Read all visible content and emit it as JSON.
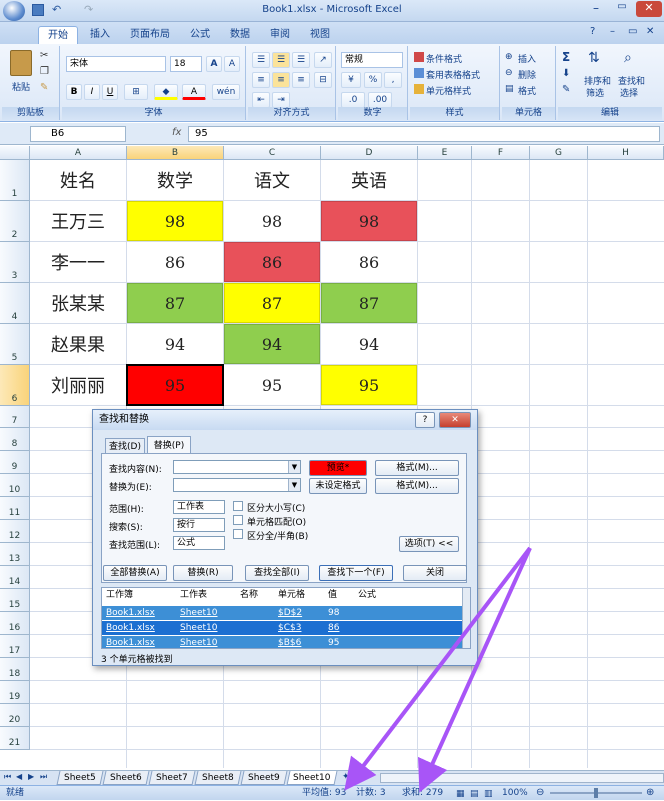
{
  "window": {
    "title": "Book1.xlsx - Microsoft Excel"
  },
  "ribbon_tabs": [
    "开始",
    "插入",
    "页面布局",
    "公式",
    "数据",
    "审阅",
    "视图"
  ],
  "ribbon": {
    "clipboard": {
      "label": "剪贴板",
      "paste": "粘贴"
    },
    "font": {
      "label": "字体",
      "name": "宋体",
      "size": "18",
      "bold": "B",
      "italic": "I",
      "underline": "U",
      "grow": "A",
      "shrink": "A",
      "phonetic": "wén"
    },
    "alignment": {
      "label": "对齐方式"
    },
    "number": {
      "label": "数字",
      "format": "常规",
      "percent": "%",
      "comma": ","
    },
    "styles": {
      "label": "样式",
      "conditional": "条件格式",
      "table": "套用表格格式",
      "cell": "单元格样式"
    },
    "cells": {
      "label": "单元格",
      "insert": "插入",
      "delete": "删除",
      "format": "格式"
    },
    "editing": {
      "label": "编辑",
      "sum": "Σ",
      "sort": "排序和",
      "sort2": "筛选",
      "find": "查找和",
      "find2": "选择"
    }
  },
  "formula_bar": {
    "name_box": "B6",
    "fx": "fx",
    "value": "95"
  },
  "columns": [
    "A",
    "B",
    "C",
    "D",
    "E",
    "F",
    "G",
    "H"
  ],
  "rows": [
    "1",
    "2",
    "3",
    "4",
    "5",
    "6",
    "7",
    "8",
    "9",
    "10",
    "11",
    "12",
    "13",
    "14",
    "15",
    "16",
    "17",
    "18",
    "19",
    "20",
    "21"
  ],
  "table": {
    "headers": [
      "姓名",
      "数学",
      "语文",
      "英语"
    ],
    "rows": [
      {
        "name": "王万三",
        "scores": [
          "98",
          "98",
          "98"
        ],
        "colors": [
          "#ffff00",
          "#ffffff",
          "#e8515a"
        ]
      },
      {
        "name": "李一一",
        "scores": [
          "86",
          "86",
          "86"
        ],
        "colors": [
          "#ffffff",
          "#e8515a",
          "#ffffff"
        ]
      },
      {
        "name": "张某某",
        "scores": [
          "87",
          "87",
          "87"
        ],
        "colors": [
          "#8fce4e",
          "#ffff00",
          "#8fce4e"
        ]
      },
      {
        "name": "赵果果",
        "scores": [
          "94",
          "94",
          "94"
        ],
        "colors": [
          "#ffffff",
          "#8fce4e",
          "#ffffff"
        ]
      },
      {
        "name": "刘丽丽",
        "scores": [
          "95",
          "95",
          "95"
        ],
        "colors": [
          "#ff0000",
          "#ffffff",
          "#ffff00"
        ]
      }
    ]
  },
  "dialog": {
    "title": "查找和替换",
    "help": "?",
    "close": "✕",
    "tab_find": "查找(D)",
    "tab_replace": "替换(P)",
    "find_label": "查找内容(N):",
    "replace_label": "替换为(E):",
    "preview": "预览*",
    "no_format": "未设定格式",
    "format_btn": "格式(M)...",
    "format_btn2": "格式(M)...",
    "scope_label": "范围(H):",
    "scope_value": "工作表",
    "search_label": "搜索(S):",
    "search_value": "按行",
    "lookin_label": "查找范围(L):",
    "lookin_value": "公式",
    "match_case": "区分大小写(C)",
    "match_cell": "单元格匹配(O)",
    "match_width": "区分全/半角(B)",
    "options_btn": "选项(T) <<",
    "replace_all": "全部替换(A)",
    "replace": "替换(R)",
    "find_all": "查找全部(I)",
    "find_next": "查找下一个(F)",
    "close_btn": "关闭",
    "results_headers": [
      "工作簿",
      "工作表",
      "名称",
      "单元格",
      "值",
      "公式"
    ],
    "results": [
      {
        "book": "Book1.xlsx",
        "sheet": "Sheet10",
        "cell": "$D$2",
        "value": "98"
      },
      {
        "book": "Book1.xlsx",
        "sheet": "Sheet10",
        "cell": "$C$3",
        "value": "86"
      },
      {
        "book": "Book1.xlsx",
        "sheet": "Sheet10",
        "cell": "$B$6",
        "value": "95"
      }
    ],
    "status": "3 个单元格被找到"
  },
  "sheet_tabs": [
    "Sheet5",
    "Sheet6",
    "Sheet7",
    "Sheet8",
    "Sheet9",
    "Sheet10"
  ],
  "status_bar": {
    "ready": "就绪",
    "average": "平均值: 93",
    "count": "计数: 3",
    "sum": "求和: 279",
    "zoom": "100%"
  },
  "colors": {
    "arrow": "#a855f7",
    "selection": "#1c6fd1"
  }
}
